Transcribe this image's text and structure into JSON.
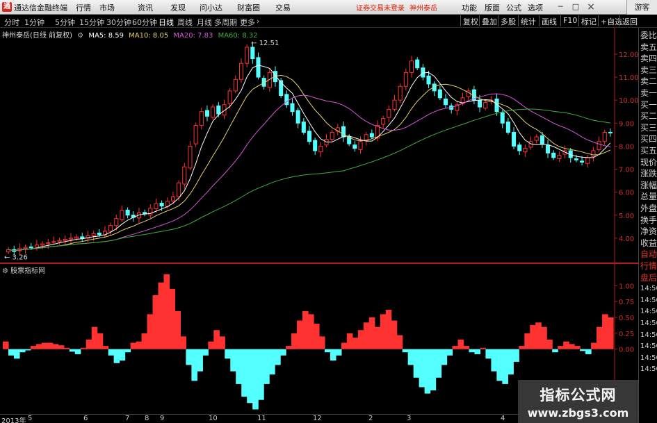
{
  "app": {
    "title": "通达信金融终端",
    "menu": [
      "行情",
      "市场",
      "资讯",
      "发现",
      "问小达",
      "财富圈",
      "交易"
    ],
    "status_warning": "证券交易未登录",
    "stock_name": "神州泰岳",
    "right_menu": [
      "功能",
      "版面",
      "公式",
      "选项"
    ],
    "guest_label": "游客",
    "win_min": "─",
    "win_max": "□",
    "win_close": "×"
  },
  "toolbar": {
    "periods": [
      "分时",
      "1分钟",
      "5分钟",
      "15分钟",
      "30分钟",
      "60分钟",
      "日线",
      "周线",
      "月线",
      "多周期",
      "更多"
    ],
    "active_period": "日线",
    "right_buttons": [
      "复权",
      "叠加",
      "多股",
      "统计",
      "画线",
      "F10",
      "标记",
      "+自选",
      "返回"
    ]
  },
  "chart_legend": {
    "title": "神州泰岳(日线 前复权)",
    "ma5": "MA5: 8.59",
    "ma10": "MA10: 8.05",
    "ma20": "MA20: 7.83",
    "ma60": "MA60: 8.32"
  },
  "sub_legend": "股票指标网",
  "side_tabs": [
    "委比",
    "卖五",
    "卖四",
    "卖三",
    "卖二",
    "卖一",
    "买一",
    "买二",
    "买三",
    "买四",
    "买五",
    "现价",
    "涨跌",
    "涨幅",
    "总量",
    "外盘",
    "换手",
    "净资",
    "收益",
    "自动",
    "行情",
    "盘后",
    "14:50",
    "14:50",
    "14:50",
    "14:50",
    "14:50",
    "14:50",
    "14:50",
    "14:50"
  ],
  "date_axis": [
    "2013年",
    "5",
    "6",
    "7",
    "8",
    "9",
    "10",
    "11",
    "12",
    "2",
    "3",
    "4"
  ],
  "colors": {
    "up": "#ff3232",
    "down": "#54ffff",
    "ma5": "#ffffff",
    "ma10": "#e8d36a",
    "ma20": "#d957d9",
    "ma60": "#3fae3f",
    "axis": "#b41e1e"
  },
  "chart_data": [
    {
      "type": "candlestick",
      "title": "神州泰岳(日线 前复权)",
      "ylim": [
        3.0,
        12.6
      ],
      "y_ticks": [
        "12.00",
        "11.00",
        "10.00",
        "9.00",
        "8.00",
        "7.00",
        "6.00",
        "5.00",
        "4.00"
      ],
      "annotations": {
        "max_label": "12.51",
        "min_label": "3.26"
      },
      "series": [
        {
          "name": "MA5",
          "last": 8.59
        },
        {
          "name": "MA10",
          "last": 8.05
        },
        {
          "name": "MA20",
          "last": 7.83
        },
        {
          "name": "MA60",
          "last": 8.32
        }
      ],
      "close": [
        3.5,
        3.42,
        3.55,
        3.6,
        3.58,
        3.7,
        3.75,
        3.8,
        3.85,
        3.9,
        3.95,
        4.0,
        4.05,
        3.98,
        4.1,
        4.2,
        4.15,
        4.3,
        4.55,
        4.85,
        5.2,
        5.0,
        4.9,
        5.1,
        5.05,
        5.3,
        5.5,
        5.4,
        5.6,
        5.8,
        6.4,
        7.1,
        8.0,
        8.9,
        9.5,
        9.3,
        9.7,
        9.4,
        9.8,
        10.4,
        10.9,
        11.6,
        12.3,
        11.8,
        11.0,
        10.6,
        11.2,
        10.8,
        10.2,
        9.8,
        9.5,
        9.0,
        8.6,
        8.2,
        7.8,
        8.0,
        8.3,
        8.6,
        8.8,
        8.4,
        8.1,
        7.9,
        8.2,
        8.5,
        8.4,
        8.9,
        9.2,
        9.6,
        10.0,
        10.6,
        11.2,
        11.7,
        11.4,
        11.0,
        10.7,
        10.4,
        10.1,
        9.8,
        9.6,
        9.8,
        10.1,
        10.4,
        10.0,
        9.7,
        9.9,
        10.0,
        9.5,
        9.0,
        8.6,
        8.0,
        7.8,
        7.9,
        8.2,
        8.4,
        8.1,
        7.7,
        7.5,
        7.6,
        7.8,
        7.5,
        7.4,
        7.3,
        7.5,
        7.8,
        8.2,
        8.6,
        8.59
      ],
      "open": [
        3.4,
        3.5,
        3.45,
        3.55,
        3.62,
        3.6,
        3.7,
        3.76,
        3.82,
        3.85,
        3.9,
        3.96,
        4.0,
        4.06,
        4.0,
        4.1,
        4.22,
        4.14,
        4.3,
        4.55,
        4.8,
        5.22,
        5.0,
        4.88,
        5.12,
        5.0,
        5.28,
        5.52,
        5.38,
        5.62,
        5.8,
        6.35,
        7.05,
        8.1,
        8.9,
        9.55,
        9.25,
        9.75,
        9.35,
        9.85,
        10.4,
        10.9,
        11.6,
        12.3,
        11.85,
        10.95,
        10.55,
        11.25,
        10.85,
        10.25,
        9.85,
        9.55,
        9.05,
        8.65,
        8.25,
        7.75,
        8.05,
        8.3,
        8.65,
        8.85,
        8.4,
        8.05,
        7.85,
        8.25,
        8.55,
        8.35,
        8.95,
        9.25,
        9.6,
        10.0,
        10.6,
        11.2,
        11.75,
        11.4,
        11.05,
        10.7,
        10.45,
        10.05,
        9.75,
        9.55,
        9.85,
        10.15,
        10.45,
        10.0,
        9.65,
        9.95,
        10.05,
        9.45,
        9.05,
        8.6,
        8.05,
        7.75,
        7.95,
        8.25,
        8.45,
        8.05,
        7.7,
        7.45,
        7.65,
        7.8,
        7.45,
        7.35,
        7.25,
        7.55,
        7.85,
        8.2,
        8.6
      ]
    },
    {
      "type": "bar",
      "title": "股票指标网",
      "ylim": [
        -1.0,
        1.2
      ],
      "y_ticks": [
        "1.00",
        "0.75",
        "0.50",
        "0.25",
        "0.00"
      ],
      "values": [
        0.12,
        -0.1,
        -0.15,
        -0.05,
        -0.02,
        0.05,
        0.08,
        0.1,
        0.1,
        0.08,
        0.06,
        0.02,
        -0.04,
        -0.08,
        0.02,
        0.15,
        0.35,
        0.25,
        0.05,
        -0.1,
        -0.22,
        -0.18,
        -0.05,
        0.1,
        0.12,
        0.25,
        0.55,
        0.85,
        1.05,
        1.18,
        0.95,
        0.6,
        0.2,
        -0.25,
        -0.5,
        -0.35,
        -0.1,
        0.12,
        0.3,
        0.2,
        -0.15,
        -0.35,
        -0.55,
        -0.75,
        -0.85,
        -0.95,
        -0.8,
        -0.55,
        -0.4,
        -0.25,
        -0.1,
        0.05,
        0.25,
        0.45,
        0.6,
        0.55,
        0.4,
        0.2,
        -0.05,
        -0.18,
        -0.1,
        0.1,
        0.25,
        0.18,
        0.3,
        0.42,
        0.5,
        0.35,
        0.55,
        0.62,
        0.45,
        0.22,
        -0.05,
        -0.25,
        -0.45,
        -0.6,
        -0.7,
        -0.65,
        -0.45,
        -0.25,
        -0.1,
        0.05,
        0.15,
        0.05,
        -0.05,
        -0.08,
        0.02,
        -0.15,
        -0.35,
        -0.5,
        -0.55,
        -0.4,
        -0.2,
        0.05,
        0.25,
        0.38,
        0.42,
        0.35,
        0.15,
        -0.05,
        0.05,
        0.12,
        0.08,
        0.05,
        -0.03,
        -0.08,
        0.1,
        0.35,
        0.55,
        0.5
      ]
    }
  ]
}
